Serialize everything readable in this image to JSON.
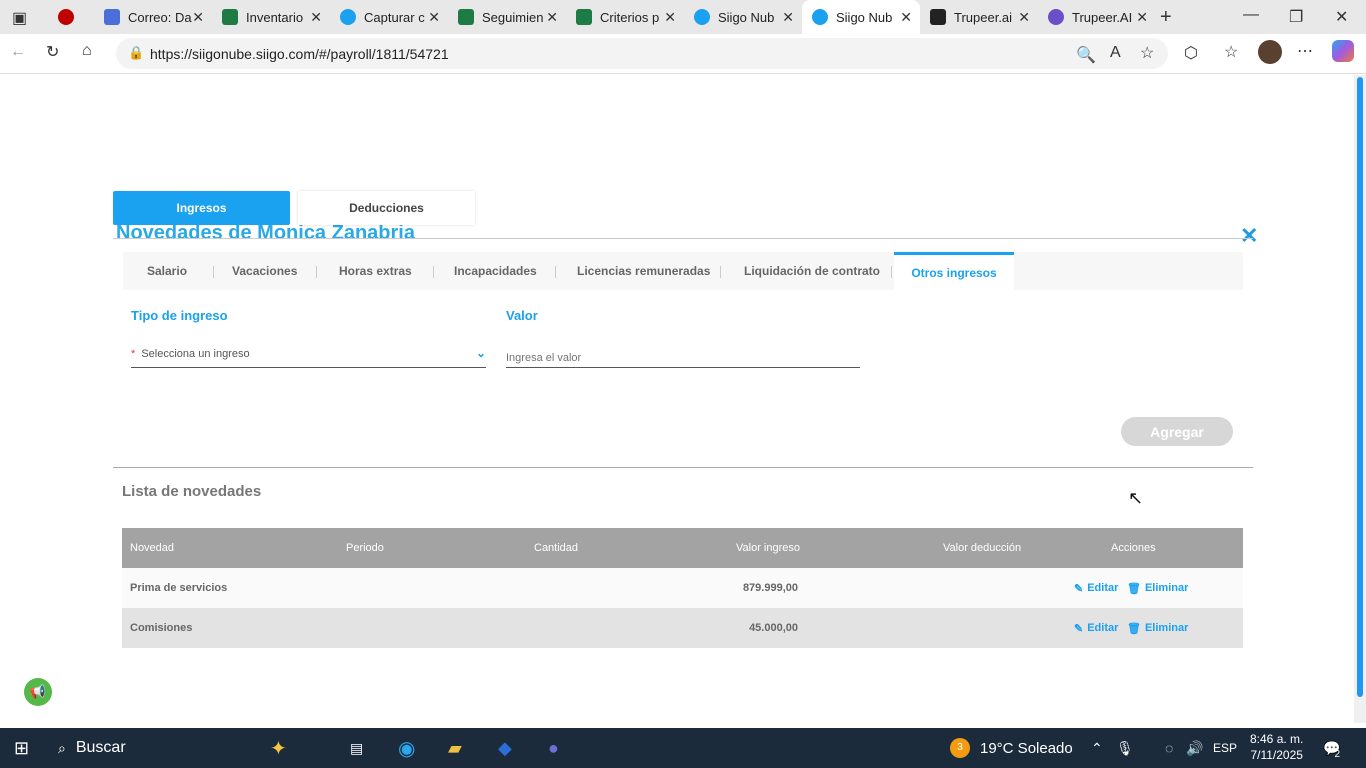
{
  "browser": {
    "tabs": [
      {
        "title": "",
        "color": "#c00000"
      },
      {
        "title": "Correo: Da",
        "color": "#4a6fd8"
      },
      {
        "title": "Inventario",
        "color": "#1e7b45"
      },
      {
        "title": "Capturar c",
        "color": "#1aa1f0"
      },
      {
        "title": "Seguimien",
        "color": "#1e7b45"
      },
      {
        "title": "Criterios p",
        "color": "#1e7b45"
      },
      {
        "title": "Siigo Nub",
        "color": "#1aa1f0"
      },
      {
        "title": "Siigo Nub",
        "color": "#1aa1f0"
      },
      {
        "title": "Trupeer.ai",
        "color": "#222222"
      },
      {
        "title": "Trupeer.AI",
        "color": "#6b4fc7"
      }
    ],
    "url": "https://siigonube.siigo.com/#/payroll/1811/54721"
  },
  "modal": {
    "title": "Novedades de Monica Zanabria",
    "main_tabs": {
      "ingresos": "Ingresos",
      "deducciones": "Deducciones"
    },
    "sub_tabs": [
      "Salario",
      "Vacaciones",
      "Horas extras",
      "Incapacidades",
      "Licencias remuneradas",
      "Liquidación de contrato",
      "Otros ingresos"
    ],
    "form": {
      "tipo_label": "Tipo de ingreso",
      "tipo_required": "*",
      "tipo_placeholder": "Selecciona un ingreso",
      "valor_label": "Valor",
      "valor_placeholder": "Ingresa el valor",
      "agregar": "Agregar"
    },
    "list": {
      "title": "Lista de novedades",
      "headers": [
        "Novedad",
        "Periodo",
        "Cantidad",
        "Valor ingreso",
        "Valor deducción",
        "Acciones"
      ],
      "rows": [
        {
          "novedad": "Prima de servicios",
          "periodo": "",
          "cantidad": "",
          "valor_ingreso": "879.999,00",
          "valor_deduccion": "",
          "editar": "Editar",
          "eliminar": "Eliminar"
        },
        {
          "novedad": "Comisiones",
          "periodo": "",
          "cantidad": "",
          "valor_ingreso": "45.000,00",
          "valor_deduccion": "",
          "editar": "Editar",
          "eliminar": "Eliminar"
        }
      ]
    }
  },
  "taskbar": {
    "search": "Buscar",
    "weather": "19°C  Soleado",
    "weather_badge": "3",
    "lang": "ESP",
    "time": "8:46 a. m.",
    "date": "7/11/2025",
    "notifications": "2"
  }
}
